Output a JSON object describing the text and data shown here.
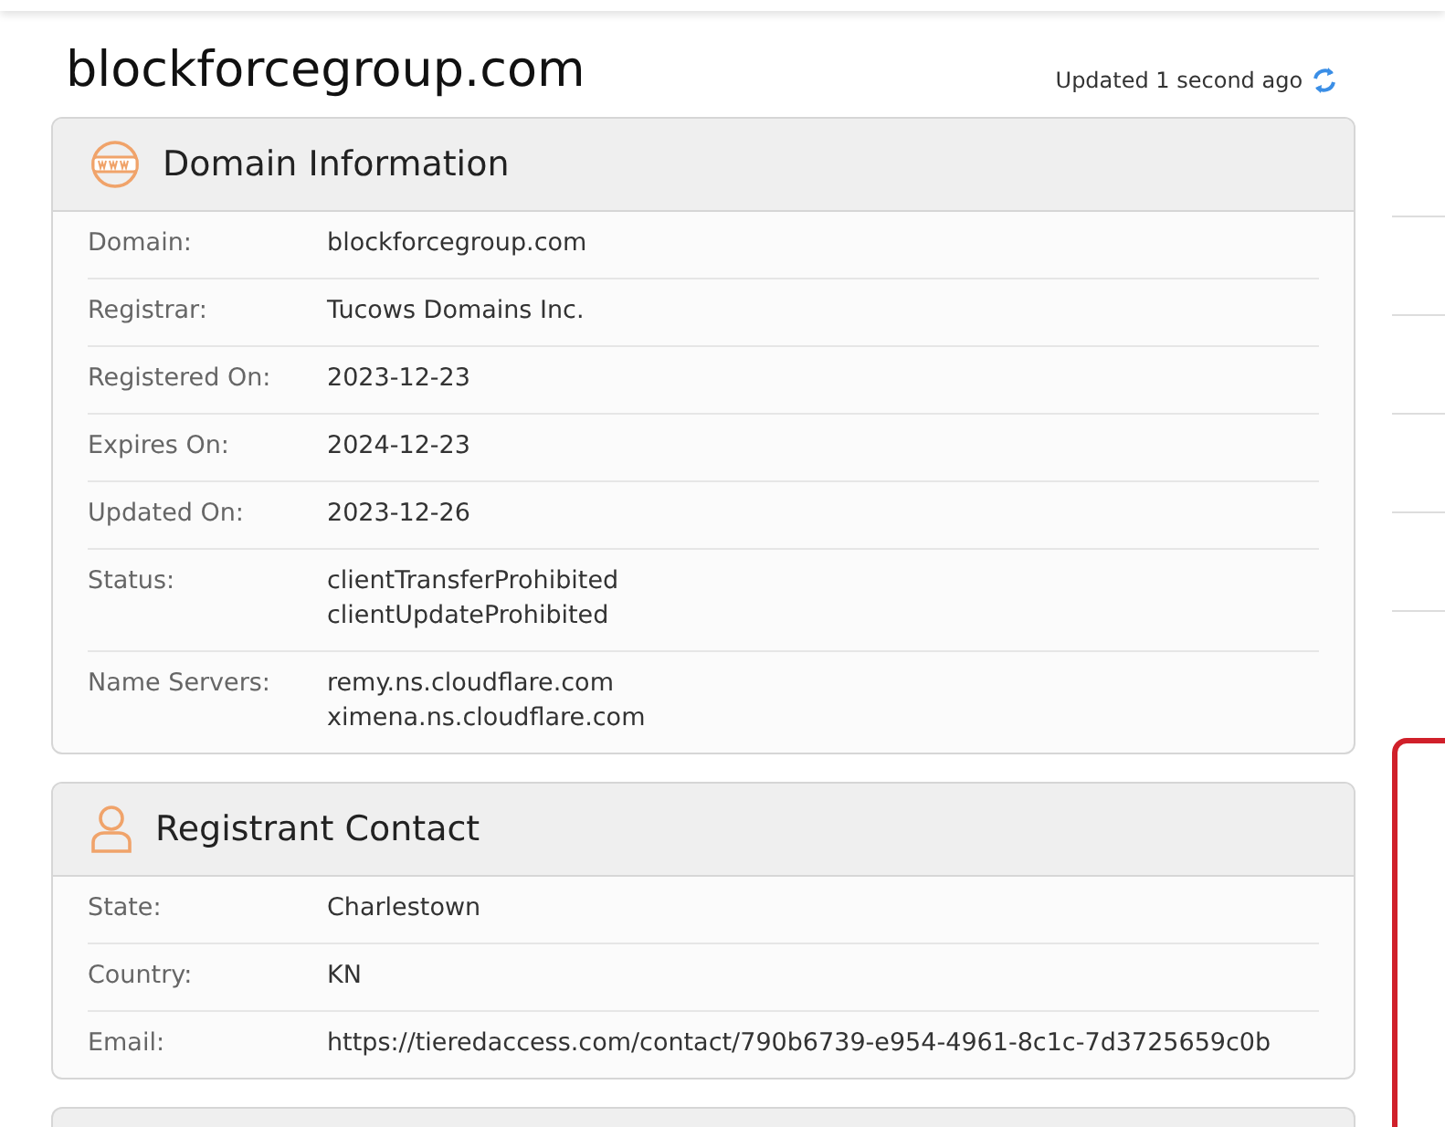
{
  "title": "blockforcegroup.com",
  "updated": "Updated 1 second ago",
  "sections": [
    {
      "kind": "domain",
      "heading": "Domain Information",
      "rows": [
        {
          "label": "Domain:",
          "values": [
            "blockforcegroup.com"
          ]
        },
        {
          "label": "Registrar:",
          "values": [
            "Tucows Domains Inc."
          ]
        },
        {
          "label": "Registered On:",
          "values": [
            "2023-12-23"
          ]
        },
        {
          "label": "Expires On:",
          "values": [
            "2024-12-23"
          ]
        },
        {
          "label": "Updated On:",
          "values": [
            "2023-12-26"
          ]
        },
        {
          "label": "Status:",
          "values": [
            "clientTransferProhibited",
            "clientUpdateProhibited"
          ]
        },
        {
          "label": "Name Servers:",
          "values": [
            "remy.ns.cloudflare.com",
            "ximena.ns.cloudflare.com"
          ]
        }
      ]
    },
    {
      "kind": "contact",
      "heading": "Registrant Contact",
      "rows": [
        {
          "label": "State:",
          "values": [
            "Charlestown"
          ]
        },
        {
          "label": "Country:",
          "values": [
            "KN"
          ]
        },
        {
          "label": "Email:",
          "values": [
            "https://tieredaccess.com/contact/790b6739-e954-4961-8c1c-7d3725659c0b"
          ]
        }
      ]
    }
  ]
}
